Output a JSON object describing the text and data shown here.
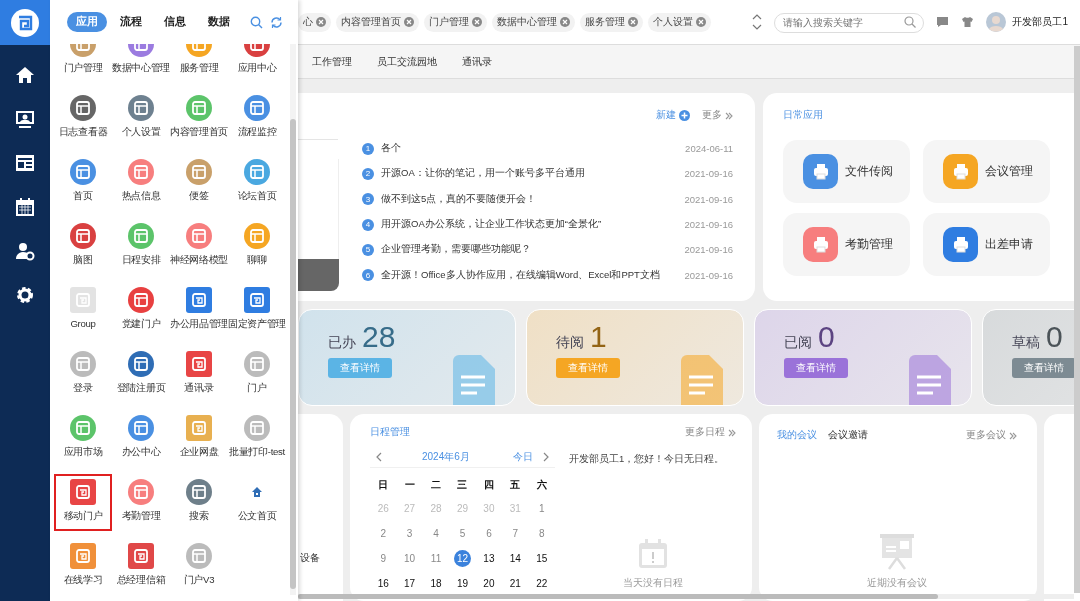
{
  "panel": {
    "tabs": [
      {
        "label": "应用",
        "selected": true
      },
      {
        "label": "流程",
        "selected": false
      },
      {
        "label": "信息",
        "selected": false
      },
      {
        "label": "数据",
        "selected": false
      }
    ],
    "apps": [
      {
        "label": "门户管理",
        "kind": "circle",
        "color": "#c9a06a",
        "selected": false
      },
      {
        "label": "数据中心管理",
        "kind": "circle",
        "color": "#9b7be0",
        "selected": false
      },
      {
        "label": "服务管理",
        "kind": "circle",
        "color": "#f5a623",
        "selected": false
      },
      {
        "label": "应用中心",
        "kind": "circle",
        "color": "#d94040",
        "selected": false
      },
      {
        "label": "日志查看器",
        "kind": "circle",
        "color": "#666666",
        "selected": false
      },
      {
        "label": "个人设置",
        "kind": "circle",
        "color": "#6e8190",
        "selected": false
      },
      {
        "label": "内容管理首页",
        "kind": "circle",
        "color": "#5cc46a",
        "selected": false
      },
      {
        "label": "流程监控",
        "kind": "circle",
        "color": "#4a90e2",
        "selected": false
      },
      {
        "label": "首页",
        "kind": "circle",
        "color": "#4a90e2",
        "selected": false
      },
      {
        "label": "热点信息",
        "kind": "circle",
        "color": "#f77e7e",
        "selected": false
      },
      {
        "label": "便签",
        "kind": "circle",
        "color": "#c9a06a",
        "selected": false
      },
      {
        "label": "论坛首页",
        "kind": "circle",
        "color": "#4aa8e0",
        "selected": false
      },
      {
        "label": "脑图",
        "kind": "circle",
        "color": "#d94040",
        "selected": false
      },
      {
        "label": "日程安排",
        "kind": "circle",
        "color": "#5cc46a",
        "selected": false
      },
      {
        "label": "神经网络模型",
        "kind": "circle",
        "color": "#f77e7e",
        "selected": false
      },
      {
        "label": "聊聊",
        "kind": "circle",
        "color": "#f5a623",
        "selected": false
      },
      {
        "label": "Group",
        "kind": "square",
        "color": "#e3e3e3",
        "selected": false
      },
      {
        "label": "党建门户",
        "kind": "circle",
        "color": "#e84040",
        "selected": false
      },
      {
        "label": "办公用品管理",
        "kind": "square",
        "color": "#2f7de1",
        "selected": false
      },
      {
        "label": "固定资产管理",
        "kind": "square",
        "color": "#2f7de1",
        "selected": false
      },
      {
        "label": "登录",
        "kind": "circle",
        "color": "#bbbbbb",
        "selected": false
      },
      {
        "label": "登陆注册页",
        "kind": "circle",
        "color": "#2f6db5",
        "selected": false
      },
      {
        "label": "通讯录",
        "kind": "square",
        "color": "#e84545",
        "selected": false
      },
      {
        "label": "门户",
        "kind": "circle",
        "color": "#bbbbbb",
        "selected": false
      },
      {
        "label": "应用市场",
        "kind": "circle",
        "color": "#5cc46a",
        "selected": false
      },
      {
        "label": "办公中心",
        "kind": "circle",
        "color": "#4a90e2",
        "selected": false
      },
      {
        "label": "企业网盘",
        "kind": "square",
        "color": "#e8b050",
        "selected": false
      },
      {
        "label": "批量打印-test",
        "kind": "circle",
        "color": "#bbbbbb",
        "selected": false
      },
      {
        "label": "移动门户",
        "kind": "square",
        "color": "#e84545",
        "selected": true
      },
      {
        "label": "考勤管理",
        "kind": "circle",
        "color": "#f77e7e",
        "selected": false
      },
      {
        "label": "搜索",
        "kind": "circle",
        "color": "#6e7f8a",
        "selected": false
      },
      {
        "label": "公文首页",
        "kind": "glyph",
        "color": "#2f6db5",
        "selected": false
      },
      {
        "label": "在线学习",
        "kind": "square",
        "color": "#f0903a",
        "selected": false
      },
      {
        "label": "总经理信箱",
        "kind": "square",
        "color": "#e04848",
        "selected": false
      },
      {
        "label": "门户V3",
        "kind": "circle",
        "color": "#bbbbbb",
        "selected": false
      }
    ]
  },
  "topbar": {
    "chips": [
      "心",
      "内容管理首页",
      "门户管理",
      "数据中心管理",
      "服务管理",
      "个人设置"
    ],
    "search": {
      "placeholder": "请输入搜索关键字"
    },
    "user": "开发部员工1"
  },
  "nav_tabs": [
    "工作管理",
    "员工交流园地",
    "通讯录"
  ],
  "news": {
    "new": "新建",
    "more": "更多",
    "items": [
      {
        "no": "1",
        "title": "各个",
        "date": "2024-06-11"
      },
      {
        "no": "2",
        "title": "开源OA：让你的笔记，用一个账号多平台通用",
        "date": "2021-09-16"
      },
      {
        "no": "3",
        "title": "做不到这5点，真的不要随便开会！",
        "date": "2021-09-16"
      },
      {
        "no": "4",
        "title": "用开源OA办公系统，让企业工作状态更加“全景化”",
        "date": "2021-09-16"
      },
      {
        "no": "5",
        "title": "企业管理考勤，需要哪些功能呢？",
        "date": "2021-09-16"
      },
      {
        "no": "6",
        "title": "全开源！Office多人协作应用，在线编辑Word、Excel和PPT文档",
        "date": "2021-09-16"
      }
    ]
  },
  "daily_apps": {
    "title": "日常应用",
    "items": [
      {
        "label": "文件传阅",
        "color": "#4a90e2"
      },
      {
        "label": "会议管理",
        "color": "#f5a623"
      },
      {
        "label": "考勤管理",
        "color": "#f77e7e"
      },
      {
        "label": "出差申请",
        "color": "#2f7de1"
      }
    ]
  },
  "stats": [
    {
      "label": "已办",
      "count": "28",
      "button": "查看详情",
      "color": "#5bb4e5"
    },
    {
      "label": "待阅",
      "count": "1",
      "button": "查看详情",
      "color": "#f5a623"
    },
    {
      "label": "已阅",
      "count": "0",
      "button": "查看详情",
      "color": "#9a72d9"
    },
    {
      "label": "草稿",
      "count": "0",
      "button": "查看详情",
      "color": "#7d8b93"
    }
  ],
  "left_card": {
    "text": "设备"
  },
  "schedule": {
    "title": "日程管理",
    "more": "更多日程",
    "month": "2024年6月",
    "today": "今日",
    "weekdays": [
      "日",
      "一",
      "二",
      "三",
      "四",
      "五",
      "六"
    ],
    "weeks": [
      [
        {
          "d": "26",
          "kind": "other",
          "selected": false
        },
        {
          "d": "27",
          "kind": "other",
          "selected": false
        },
        {
          "d": "28",
          "kind": "other",
          "selected": false
        },
        {
          "d": "29",
          "kind": "other",
          "selected": false
        },
        {
          "d": "30",
          "kind": "other",
          "selected": false
        },
        {
          "d": "31",
          "kind": "other",
          "selected": false
        },
        {
          "d": "1",
          "kind": "past",
          "selected": false
        }
      ],
      [
        {
          "d": "2",
          "kind": "past",
          "selected": false
        },
        {
          "d": "3",
          "kind": "past",
          "selected": false
        },
        {
          "d": "4",
          "kind": "past",
          "selected": false
        },
        {
          "d": "5",
          "kind": "past",
          "selected": false
        },
        {
          "d": "6",
          "kind": "past",
          "selected": false
        },
        {
          "d": "7",
          "kind": "past",
          "selected": false
        },
        {
          "d": "8",
          "kind": "past",
          "selected": false
        }
      ],
      [
        {
          "d": "9",
          "kind": "past",
          "selected": false
        },
        {
          "d": "10",
          "kind": "past",
          "selected": false
        },
        {
          "d": "11",
          "kind": "past",
          "selected": false
        },
        {
          "d": "12",
          "kind": "current",
          "selected": true
        },
        {
          "d": "13",
          "kind": "current",
          "selected": false
        },
        {
          "d": "14",
          "kind": "current",
          "selected": false
        },
        {
          "d": "15",
          "kind": "current",
          "selected": false
        }
      ],
      [
        {
          "d": "16",
          "kind": "current",
          "selected": false
        },
        {
          "d": "17",
          "kind": "current",
          "selected": false
        },
        {
          "d": "18",
          "kind": "current",
          "selected": false
        },
        {
          "d": "19",
          "kind": "current",
          "selected": false
        },
        {
          "d": "20",
          "kind": "current",
          "selected": false
        },
        {
          "d": "21",
          "kind": "current",
          "selected": false
        },
        {
          "d": "22",
          "kind": "current",
          "selected": false
        }
      ]
    ],
    "greeting": "开发部员工1，您好！今日无日程。",
    "empty": "当天没有日程"
  },
  "meetings": {
    "tabs": [
      {
        "label": "我的会议",
        "selected": true
      },
      {
        "label": "会议邀请",
        "selected": false
      }
    ],
    "more": "更多会议",
    "empty": "近期没有会议"
  }
}
